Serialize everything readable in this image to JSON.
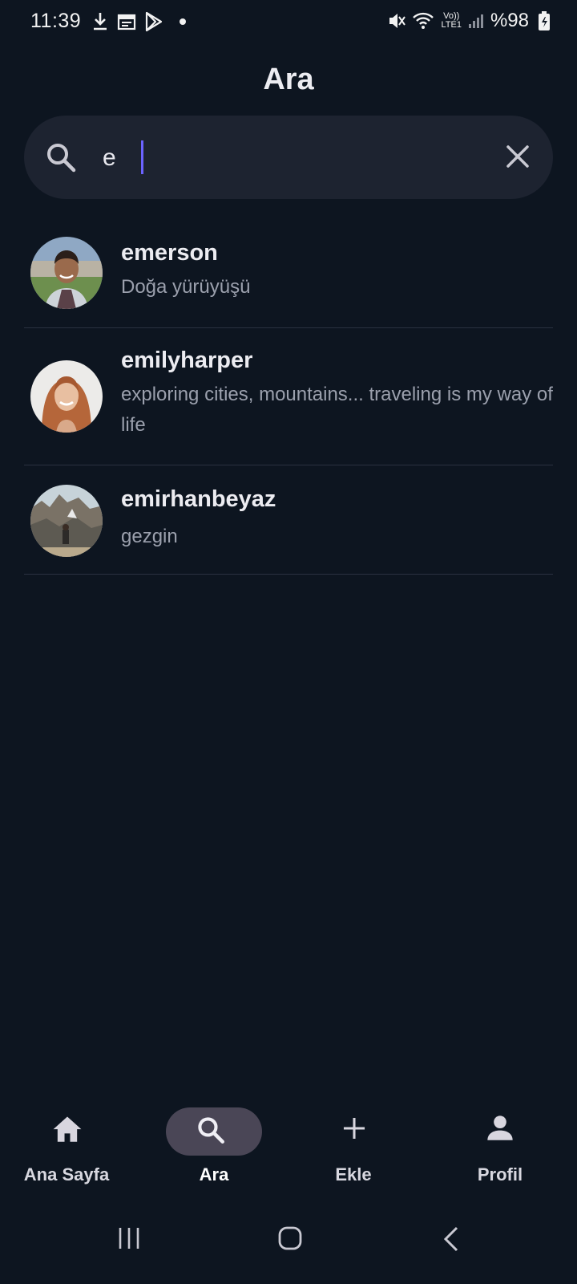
{
  "status_bar": {
    "time": "11:39",
    "battery": "%98",
    "network": "LTE1",
    "volte": "Vo))"
  },
  "header": {
    "title": "Ara"
  },
  "search": {
    "value": "e",
    "placeholder": ""
  },
  "results": [
    {
      "username": "emerson",
      "bio": "Doğa yürüyüşü"
    },
    {
      "username": "emilyharper",
      "bio": "exploring cities, mountains... traveling is my way of life"
    },
    {
      "username": "emirhanbeyaz",
      "bio": "gezgin"
    }
  ],
  "nav": {
    "items": [
      {
        "label": "Ana Sayfa",
        "icon": "home-icon",
        "active": false
      },
      {
        "label": "Ara",
        "icon": "search-icon",
        "active": true
      },
      {
        "label": "Ekle",
        "icon": "plus-icon",
        "active": false
      },
      {
        "label": "Profil",
        "icon": "person-icon",
        "active": false
      }
    ]
  },
  "colors": {
    "background": "#0d1520",
    "search_bg": "#1d2330",
    "active_pill": "#4a4656",
    "caret": "#6c63ff"
  }
}
